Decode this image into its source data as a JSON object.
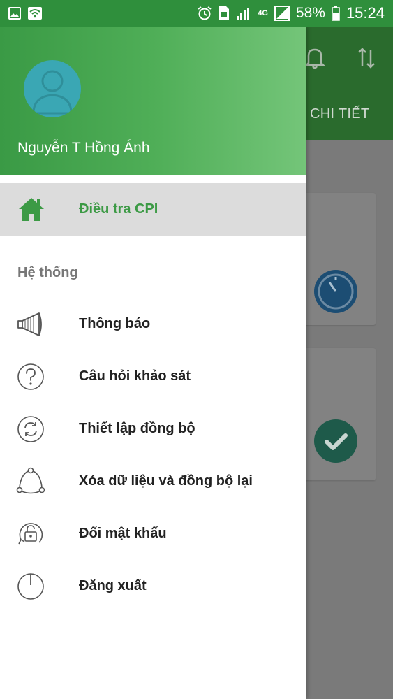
{
  "status_bar": {
    "battery": "58%",
    "time": "15:24",
    "network": "4G"
  },
  "background_app": {
    "tab_label": "CHI TIẾT"
  },
  "drawer": {
    "user_name": "Nguyễn T Hồng Ánh",
    "active_item": {
      "label": "Điều tra CPI",
      "icon": "home-icon"
    },
    "section_title": "Hệ thống",
    "items": [
      {
        "label": "Thông báo",
        "icon": "megaphone-icon"
      },
      {
        "label": "Câu hỏi khảo sát",
        "icon": "question-icon"
      },
      {
        "label": "Thiết lập đồng bộ",
        "icon": "sync-icon"
      },
      {
        "label": "Xóa dữ liệu và đồng bộ lại",
        "icon": "share-nodes-icon"
      },
      {
        "label": "Đổi mật khẩu",
        "icon": "lock-icon"
      },
      {
        "label": "Đăng xuất",
        "icon": "power-icon"
      }
    ]
  },
  "colors": {
    "primary_green": "#3c9a45",
    "header_gradient_end": "#74c579",
    "active_item_bg": "#dcdcdc"
  }
}
